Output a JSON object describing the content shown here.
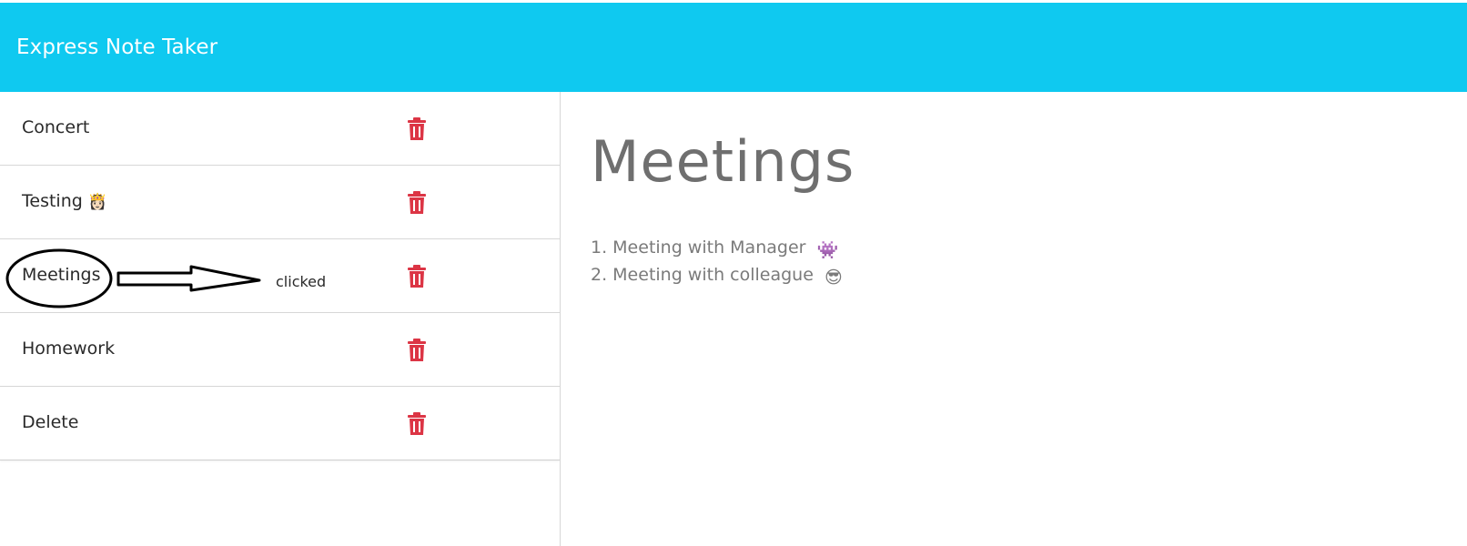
{
  "header": {
    "title": "Express Note Taker"
  },
  "notes": [
    {
      "title": "Concert",
      "emoji": ""
    },
    {
      "title": "Testing",
      "emoji": "👸🏻"
    },
    {
      "title": "Meetings",
      "emoji": ""
    },
    {
      "title": "Homework",
      "emoji": ""
    },
    {
      "title": "Delete",
      "emoji": ""
    }
  ],
  "active_note": {
    "title": "Meetings",
    "lines": [
      {
        "text": "1. Meeting with Manager",
        "emoji": "👾"
      },
      {
        "text": "2. Meeting with colleague",
        "emoji": "😎"
      }
    ]
  },
  "annotation": {
    "label": "clicked"
  },
  "colors": {
    "header_bg": "#0fc9f0",
    "delete_icon": "#dc3545",
    "heading_text": "#6f6f6f"
  },
  "icons": {
    "delete": "trash-icon"
  }
}
